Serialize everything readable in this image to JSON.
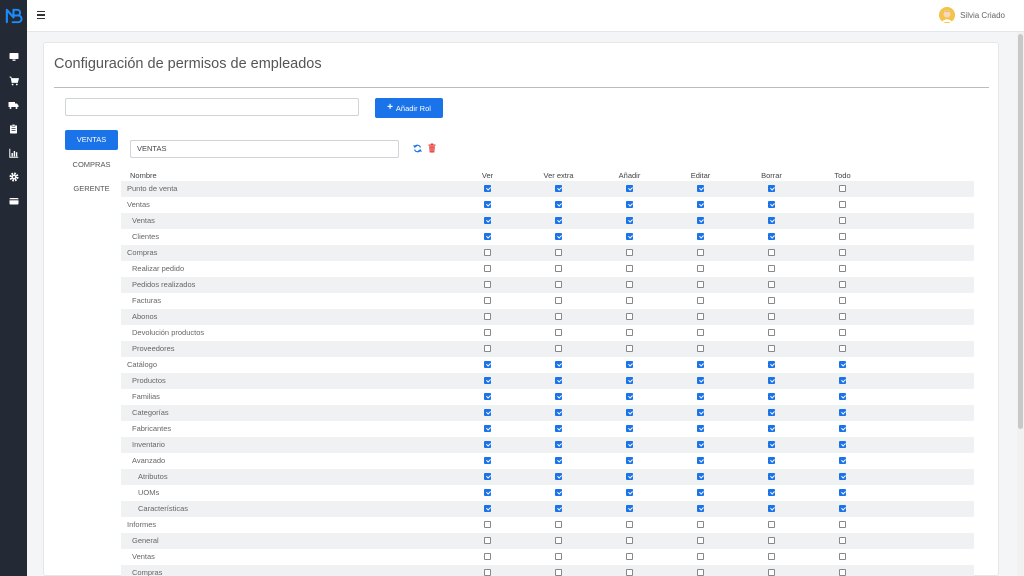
{
  "app": {
    "user_name": "Silvia Criado",
    "brand_color": "#1a73e8",
    "sidebar_icons": [
      "desktop-icon",
      "cart-icon",
      "truck-icon",
      "clipboard-icon",
      "chart-icon",
      "gear-icon",
      "wallet-icon"
    ]
  },
  "page": {
    "title": "Configuración de permisos de empleados",
    "role_input": {
      "value": "",
      "placeholder": ""
    },
    "add_role_label": "Añadir Rol"
  },
  "roles": {
    "tabs": [
      "VENTAS",
      "COMPRAS",
      "GERENTE"
    ],
    "active_tab": "VENTAS",
    "selected_name": "VENTAS"
  },
  "permissions": {
    "header_name": "Nombre",
    "columns": [
      "Ver",
      "Ver extra",
      "Añadir",
      "Editar",
      "Borrar",
      "Todo"
    ],
    "rows": [
      {
        "label": "Punto de venta",
        "level": 0,
        "checks": [
          true,
          true,
          true,
          true,
          true,
          false
        ]
      },
      {
        "label": "Ventas",
        "level": 0,
        "checks": [
          true,
          true,
          true,
          true,
          true,
          false
        ]
      },
      {
        "label": "Ventas",
        "level": 1,
        "checks": [
          true,
          true,
          true,
          true,
          true,
          false
        ]
      },
      {
        "label": "Clientes",
        "level": 1,
        "checks": [
          true,
          true,
          true,
          true,
          true,
          false
        ]
      },
      {
        "label": "Compras",
        "level": 0,
        "checks": [
          false,
          false,
          false,
          false,
          false,
          false
        ]
      },
      {
        "label": "Realizar pedido",
        "level": 1,
        "checks": [
          false,
          false,
          false,
          false,
          false,
          false
        ]
      },
      {
        "label": "Pedidos realizados",
        "level": 1,
        "checks": [
          false,
          false,
          false,
          false,
          false,
          false
        ]
      },
      {
        "label": "Facturas",
        "level": 1,
        "checks": [
          false,
          false,
          false,
          false,
          false,
          false
        ]
      },
      {
        "label": "Abonos",
        "level": 1,
        "checks": [
          false,
          false,
          false,
          false,
          false,
          false
        ]
      },
      {
        "label": "Devolución productos",
        "level": 1,
        "checks": [
          false,
          false,
          false,
          false,
          false,
          false
        ]
      },
      {
        "label": "Proveedores",
        "level": 1,
        "checks": [
          false,
          false,
          false,
          false,
          false,
          false
        ]
      },
      {
        "label": "Catálogo",
        "level": 0,
        "checks": [
          true,
          true,
          true,
          true,
          true,
          true
        ]
      },
      {
        "label": "Productos",
        "level": 1,
        "checks": [
          true,
          true,
          true,
          true,
          true,
          true
        ]
      },
      {
        "label": "Familias",
        "level": 1,
        "checks": [
          true,
          true,
          true,
          true,
          true,
          true
        ]
      },
      {
        "label": "Categorías",
        "level": 1,
        "checks": [
          true,
          true,
          true,
          true,
          true,
          true
        ]
      },
      {
        "label": "Fabricantes",
        "level": 1,
        "checks": [
          true,
          true,
          true,
          true,
          true,
          true
        ]
      },
      {
        "label": "Inventario",
        "level": 1,
        "checks": [
          true,
          true,
          true,
          true,
          true,
          true
        ]
      },
      {
        "label": "Avanzado",
        "level": 1,
        "checks": [
          true,
          true,
          true,
          true,
          true,
          true
        ]
      },
      {
        "label": "Atributos",
        "level": 2,
        "checks": [
          true,
          true,
          true,
          true,
          true,
          true
        ]
      },
      {
        "label": "UOMs",
        "level": 2,
        "checks": [
          true,
          true,
          true,
          true,
          true,
          true
        ]
      },
      {
        "label": "Características",
        "level": 2,
        "checks": [
          true,
          true,
          true,
          true,
          true,
          true
        ]
      },
      {
        "label": "Informes",
        "level": 0,
        "checks": [
          false,
          false,
          false,
          false,
          false,
          false
        ]
      },
      {
        "label": "General",
        "level": 1,
        "checks": [
          false,
          false,
          false,
          false,
          false,
          false
        ]
      },
      {
        "label": "Ventas",
        "level": 1,
        "checks": [
          false,
          false,
          false,
          false,
          false,
          false
        ]
      },
      {
        "label": "Compras",
        "level": 1,
        "checks": [
          false,
          false,
          false,
          false,
          false,
          false
        ]
      }
    ]
  }
}
